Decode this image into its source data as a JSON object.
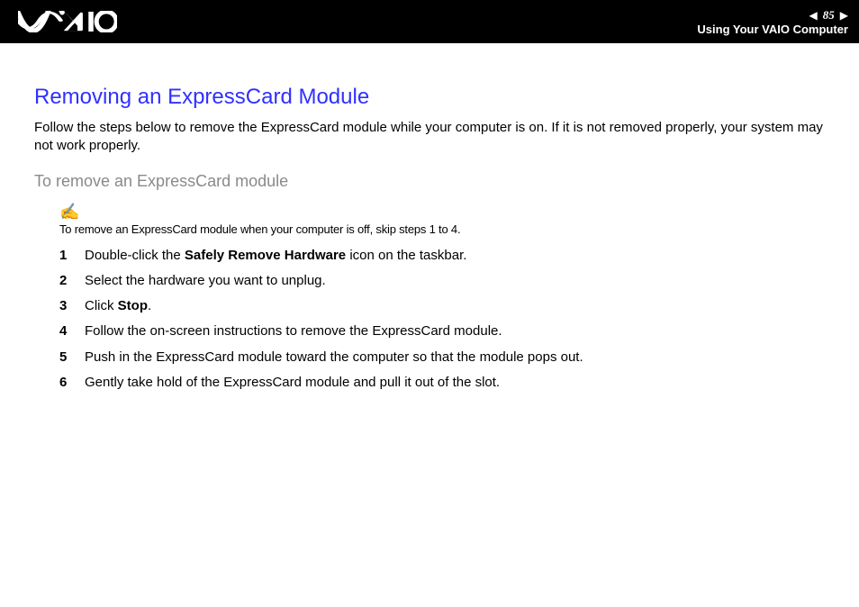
{
  "header": {
    "page_number": "85",
    "section": "Using Your VAIO Computer"
  },
  "title": "Removing an ExpressCard Module",
  "intro": "Follow the steps below to remove the ExpressCard module while your computer is on. If it is not removed properly, your system may not work properly.",
  "subhead": "To remove an ExpressCard module",
  "note": "To remove an ExpressCard module when your computer is off, skip steps 1 to 4.",
  "steps": [
    {
      "n": "1",
      "pre": "Double-click the ",
      "bold": "Safely Remove Hardware",
      "post": " icon on the taskbar."
    },
    {
      "n": "2",
      "pre": "Select the hardware you want to unplug.",
      "bold": "",
      "post": ""
    },
    {
      "n": "3",
      "pre": "Click ",
      "bold": "Stop",
      "post": "."
    },
    {
      "n": "4",
      "pre": "Follow the on-screen instructions to remove the ExpressCard module.",
      "bold": "",
      "post": ""
    },
    {
      "n": "5",
      "pre": "Push in the ExpressCard module toward the computer so that the module pops out.",
      "bold": "",
      "post": ""
    },
    {
      "n": "6",
      "pre": "Gently take hold of the ExpressCard module and pull it out of the slot.",
      "bold": "",
      "post": ""
    }
  ]
}
